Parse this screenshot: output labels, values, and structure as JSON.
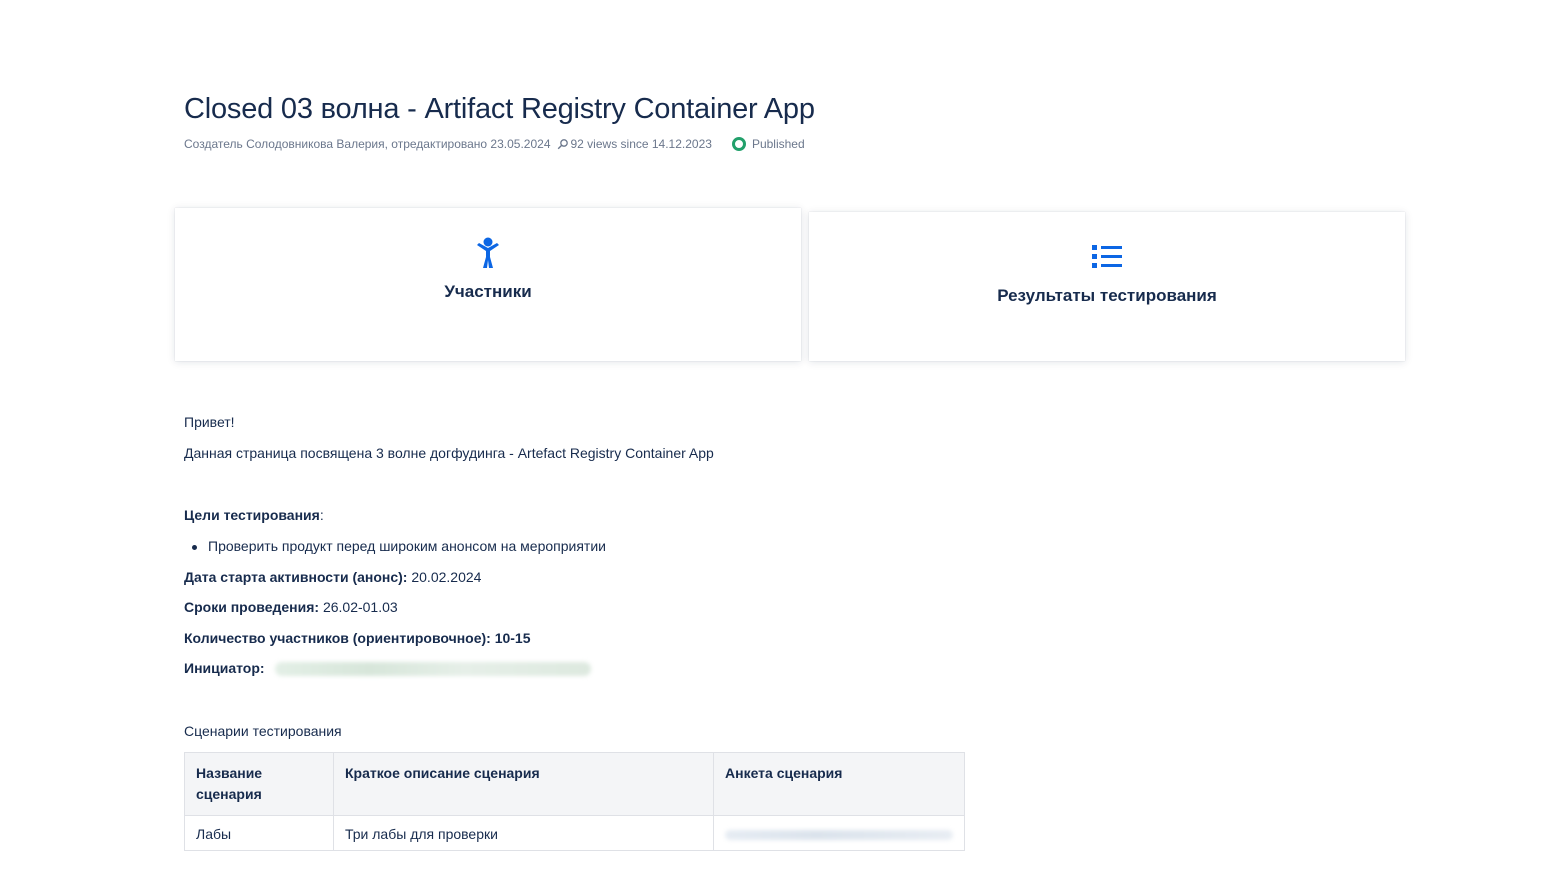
{
  "page": {
    "title": "Closed 03 волна - Artifact Registry Container App",
    "byline": "Создатель Солодовникова Валерия, отредактировано 23.05.2024",
    "views": "92 views since 14.12.2023",
    "status": "Published"
  },
  "cards": [
    {
      "label": "Участники",
      "icon": "person-icon"
    },
    {
      "label": "Результаты тестирования",
      "icon": "list-icon"
    }
  ],
  "body": {
    "greeting": "Привет!",
    "intro": "Данная страница посвящена 3 волне догфудинга - Artefact Registry Container App",
    "goals_label": "Цели тестирования",
    "goals_colon": ":",
    "goals": [
      "Проверить продукт перед широким анонсом на мероприятии"
    ],
    "start_label": "Дата старта активности (анонс):",
    "start_value": " 20.02.2024",
    "period_label": "Сроки проведения:",
    "period_value": " 26.02-01.03",
    "participants_label": "Количество участников (ориентировочное): 10-15",
    "initiator_label": "Инициатор:",
    "scenarios_caption": "Сценарии тестирования"
  },
  "table": {
    "headers": [
      "Название сценария",
      "Краткое описание сценария",
      "Анкета сценария"
    ],
    "rows": [
      {
        "name": "Лабы",
        "description": "Три лабы для проверки"
      }
    ]
  },
  "colors": {
    "text": "#172b4d",
    "muted": "#6b778c",
    "accent": "#0c66e4",
    "published": "#22a06b"
  }
}
